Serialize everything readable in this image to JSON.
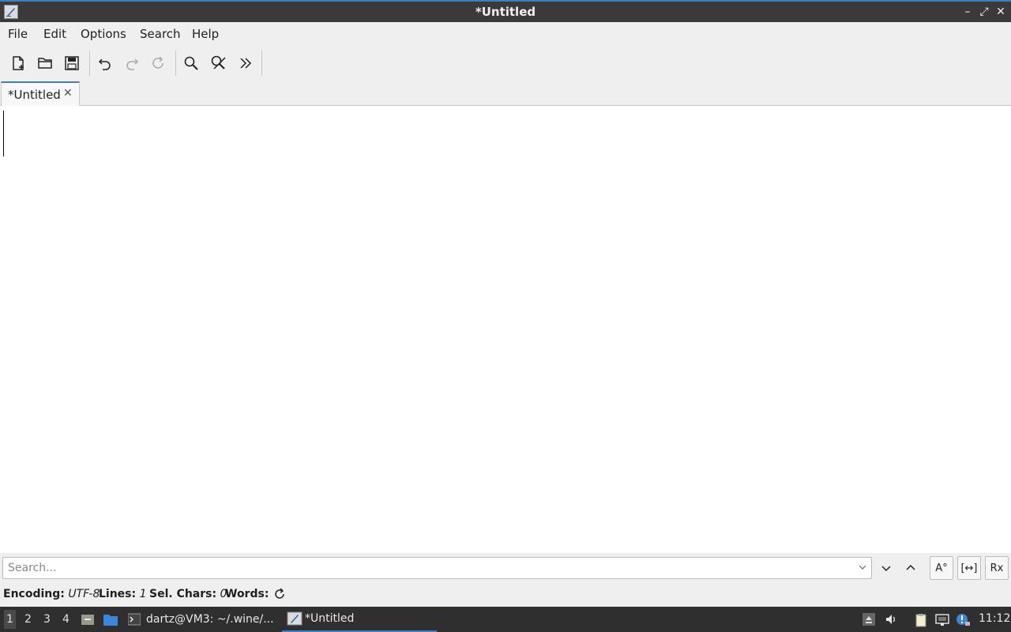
{
  "window": {
    "title": "*Untitled",
    "buttons": {
      "minimize": "–",
      "maximize": "⤢",
      "close": "✕"
    }
  },
  "menu": [
    "File",
    "Edit",
    "Options",
    "Search",
    "Help"
  ],
  "toolbar": {
    "icons": [
      "new-document-icon",
      "open-folder-icon",
      "save-icon",
      "undo-icon",
      "redo-icon",
      "reload-icon",
      "find-icon",
      "find-replace-icon",
      "more-icon"
    ]
  },
  "tabs": [
    {
      "label": "*Untitled",
      "close": "✕"
    }
  ],
  "editor": {
    "content": ""
  },
  "search": {
    "placeholder": "Search...",
    "value": "",
    "options": [
      "A°",
      "[↔]",
      "Rx"
    ]
  },
  "status": {
    "encoding_label": "Encoding:",
    "encoding_value": "UTF-8",
    "lines_label": "Lines:",
    "lines_value": "1",
    "selchars_label": "Sel. Chars:",
    "selchars_value": "0",
    "words_label": "Words:"
  },
  "taskbar": {
    "workspaces": [
      "1",
      "2",
      "3",
      "4"
    ],
    "tasks": [
      {
        "label": "dartz@VM3: ~/.wine/..."
      },
      {
        "label": "*Untitled"
      }
    ],
    "clock": "11:12"
  },
  "colors": {
    "accent": "#3d7fc7",
    "titlebar": "#3a3a3a",
    "taskbar": "#2f2f2f"
  }
}
